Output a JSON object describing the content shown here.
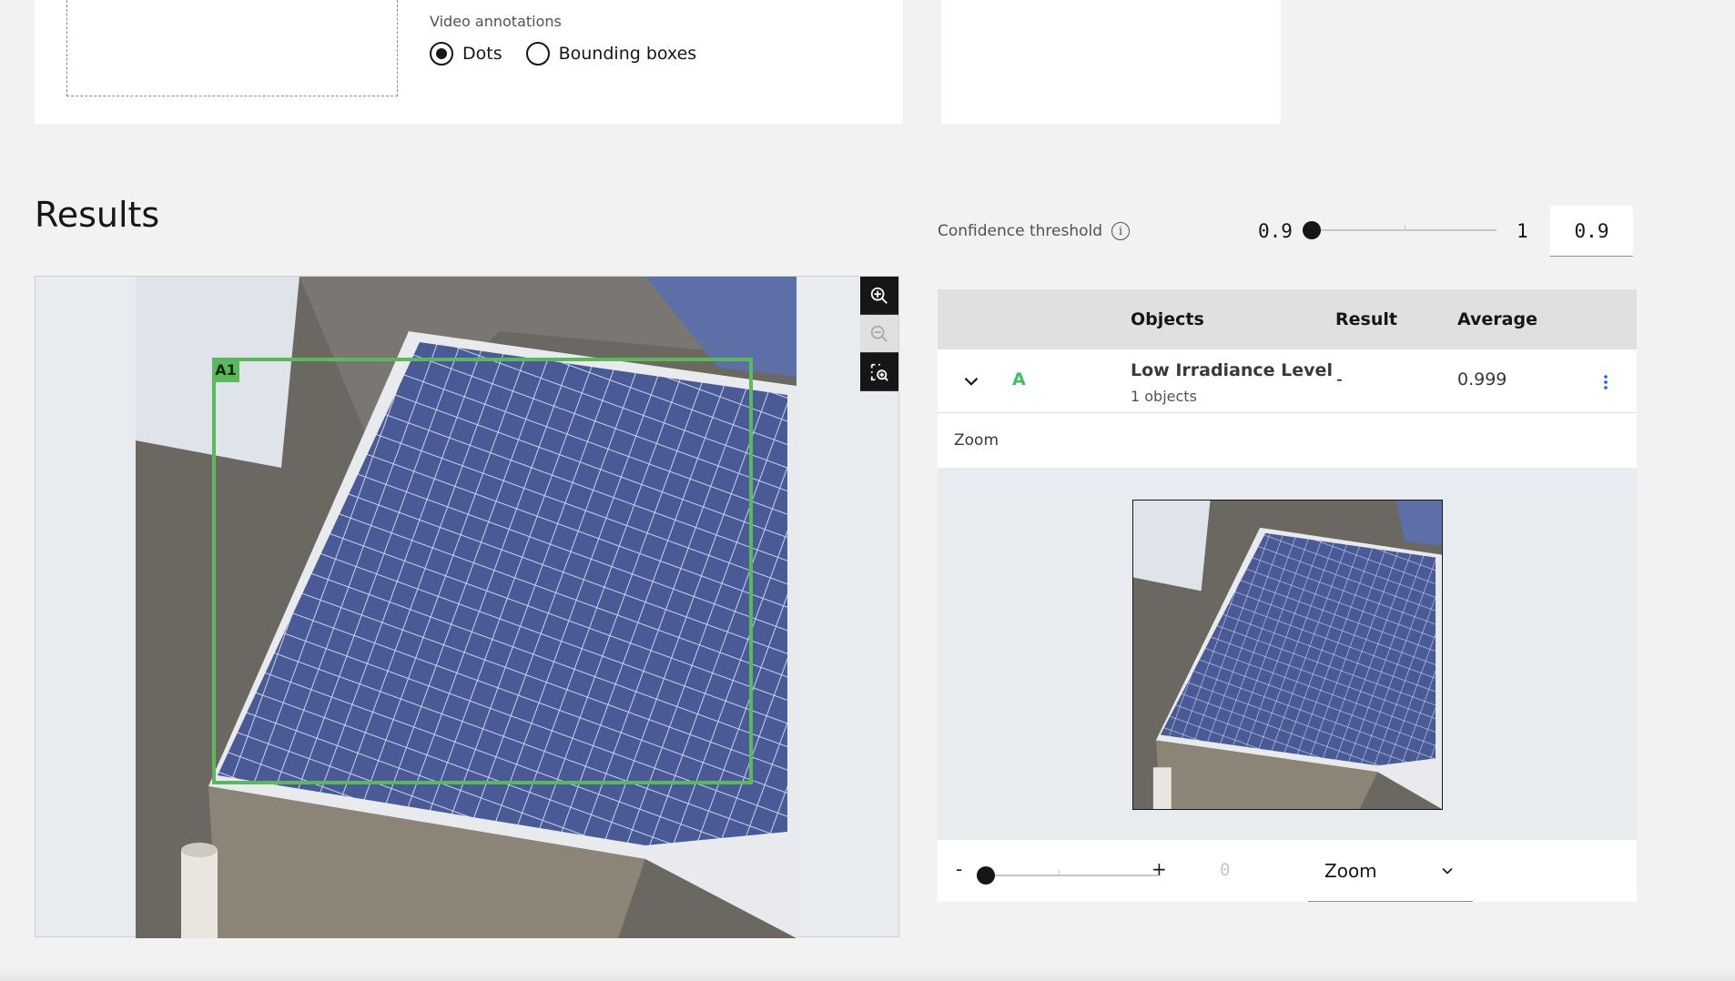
{
  "upload": {
    "video_annotations_label": "Video annotations",
    "options": [
      {
        "label": "Dots",
        "checked": true
      },
      {
        "label": "Bounding boxes",
        "checked": false
      }
    ]
  },
  "results": {
    "title": "Results",
    "bbox_tag": "A1",
    "tools": [
      "zoom-in-icon",
      "zoom-out-icon",
      "fit-to-view-icon"
    ]
  },
  "confidence": {
    "label": "Confidence threshold",
    "min": "0.9",
    "max": "1",
    "value": "0.9",
    "slider_level": 0.0
  },
  "table": {
    "headers": {
      "objects": "Objects",
      "result": "Result",
      "average": "Average"
    },
    "row": {
      "letter": "A",
      "name": "Low Irradiance Level",
      "count": "1 objects",
      "result": "-",
      "average": "0.999"
    },
    "zoom_label": "Zoom"
  },
  "zoom_controls": {
    "minus": "-",
    "plus": "+",
    "value": "0",
    "select_value": "Zoom",
    "slider_level": 0.0
  },
  "colors": {
    "bbox": "#5cb85c",
    "accent_letter": "#42be65"
  }
}
